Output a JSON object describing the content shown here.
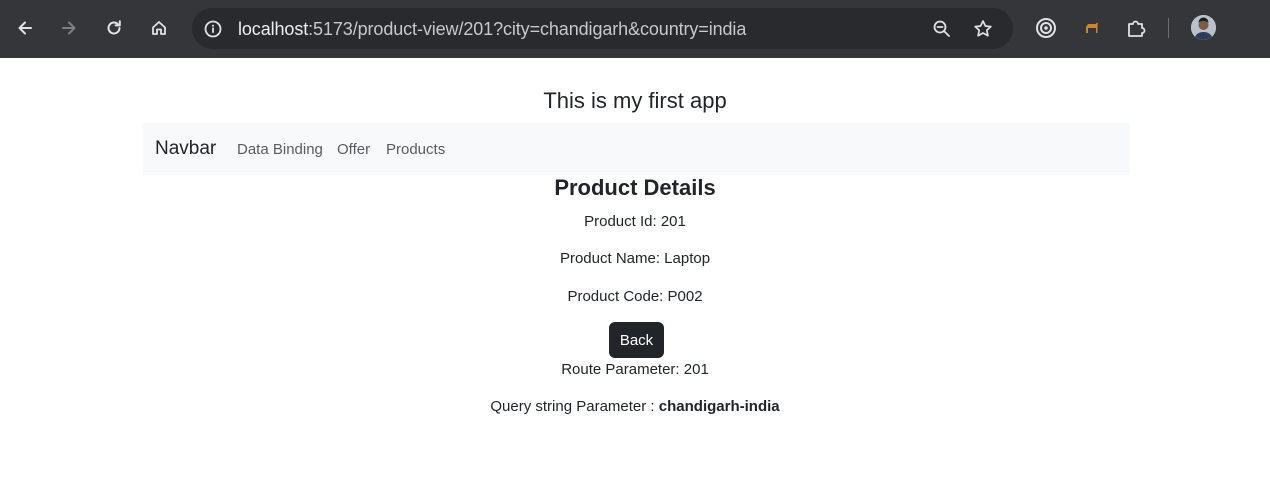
{
  "browser": {
    "url_host": "localhost",
    "url_rest": ":5173/product-view/201?city=chandigarh&country=india",
    "icons": [
      "back-arrow-icon",
      "forward-arrow-icon",
      "reload-icon",
      "home-icon",
      "site-info-icon",
      "zoom-icon",
      "star-icon",
      "extension-target-icon",
      "extension-animal-icon",
      "extensions-puzzle-icon",
      "profile-avatar"
    ]
  },
  "page": {
    "app_title": "This is my first app",
    "navbar": {
      "brand": "Navbar",
      "links": [
        "Data Binding",
        "Offer",
        "Products"
      ]
    },
    "details": {
      "title": "Product Details",
      "product_id": "Product Id: 201",
      "product_name": "Product Name: Laptop",
      "product_code": "Product Code: P002",
      "back_label": "Back",
      "route_param": "Route Parameter: 201",
      "query_label": "Query string Parameter : ",
      "query_value": "chandigarh-india"
    }
  },
  "colors": {
    "chrome_bg": "#35363a",
    "omnibox_bg": "#282a2d",
    "navbar_bg": "#f8f9fa",
    "button_dark": "#212529",
    "text": "#212529"
  }
}
